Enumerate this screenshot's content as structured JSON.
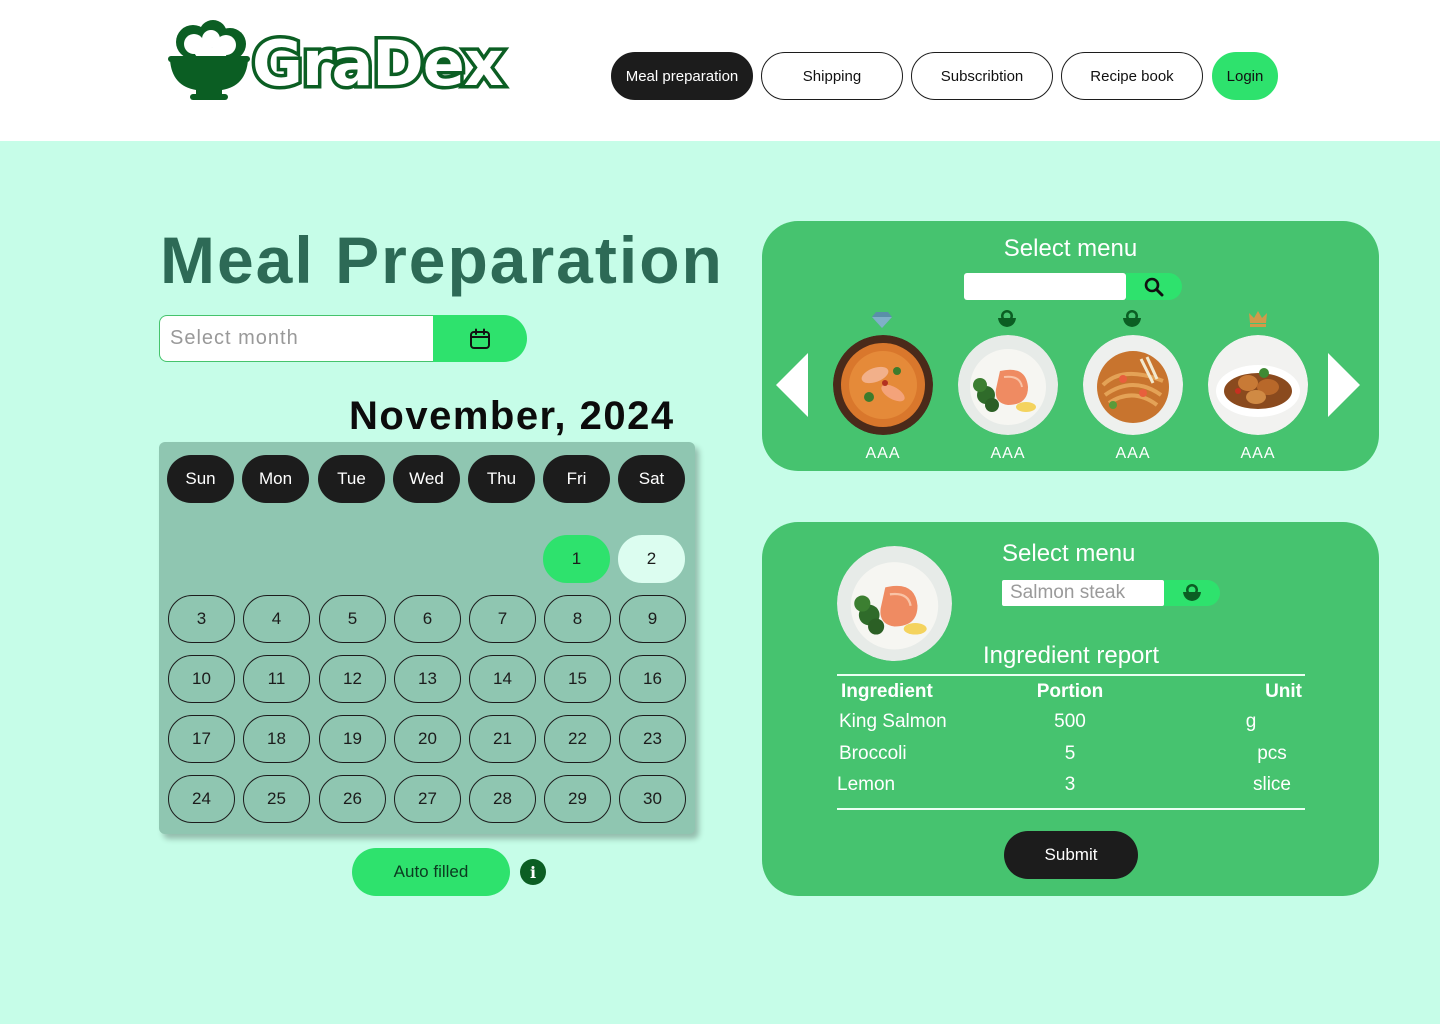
{
  "brand": {
    "name": "GraDex",
    "color": "#0b5e23",
    "accent": "#2ee26d"
  },
  "nav": {
    "items": [
      {
        "label": "Meal preparation",
        "active": true
      },
      {
        "label": "Shipping"
      },
      {
        "label": "Subscribtion"
      },
      {
        "label": "Recipe book"
      }
    ],
    "login": "Login"
  },
  "page": {
    "title": "Meal Preparation"
  },
  "month_picker": {
    "placeholder": "Select month",
    "icon": "calendar-icon"
  },
  "calendar": {
    "heading": "November, 2024",
    "weekdays": [
      "Sun",
      "Mon",
      "Tue",
      "Wed",
      "Thu",
      "Fri",
      "Sat"
    ],
    "first_weekday_index": 5,
    "days": [
      "1",
      "2",
      "3",
      "4",
      "5",
      "6",
      "7",
      "8",
      "9",
      "10",
      "11",
      "12",
      "13",
      "14",
      "15",
      "16",
      "17",
      "18",
      "19",
      "20",
      "21",
      "22",
      "23",
      "24",
      "25",
      "26",
      "27",
      "28",
      "29",
      "30"
    ],
    "highlighted": [
      "1",
      "2"
    ]
  },
  "auto_fill": {
    "label": "Auto filled",
    "info_icon": "i"
  },
  "menu_select": {
    "title": "Select menu",
    "search_icon": "search-icon",
    "items": [
      {
        "label": "AAA",
        "badge": "diamond-icon"
      },
      {
        "label": "AAA",
        "badge": "rice-bowl-icon"
      },
      {
        "label": "AAA",
        "badge": "rice-bowl-icon"
      },
      {
        "label": "AAA",
        "badge": "crown-icon"
      }
    ]
  },
  "ingredient_panel": {
    "title": "Select menu",
    "menu_value": "Salmon steak",
    "report_title": "Ingredient report",
    "columns": [
      "Ingredient",
      "Portion",
      "Unit"
    ],
    "rows": [
      [
        "King Salmon",
        "500",
        "g"
      ],
      [
        "Broccoli",
        "5",
        "pcs"
      ],
      [
        "Lemon",
        "3",
        "slice"
      ]
    ],
    "submit": "Submit"
  }
}
